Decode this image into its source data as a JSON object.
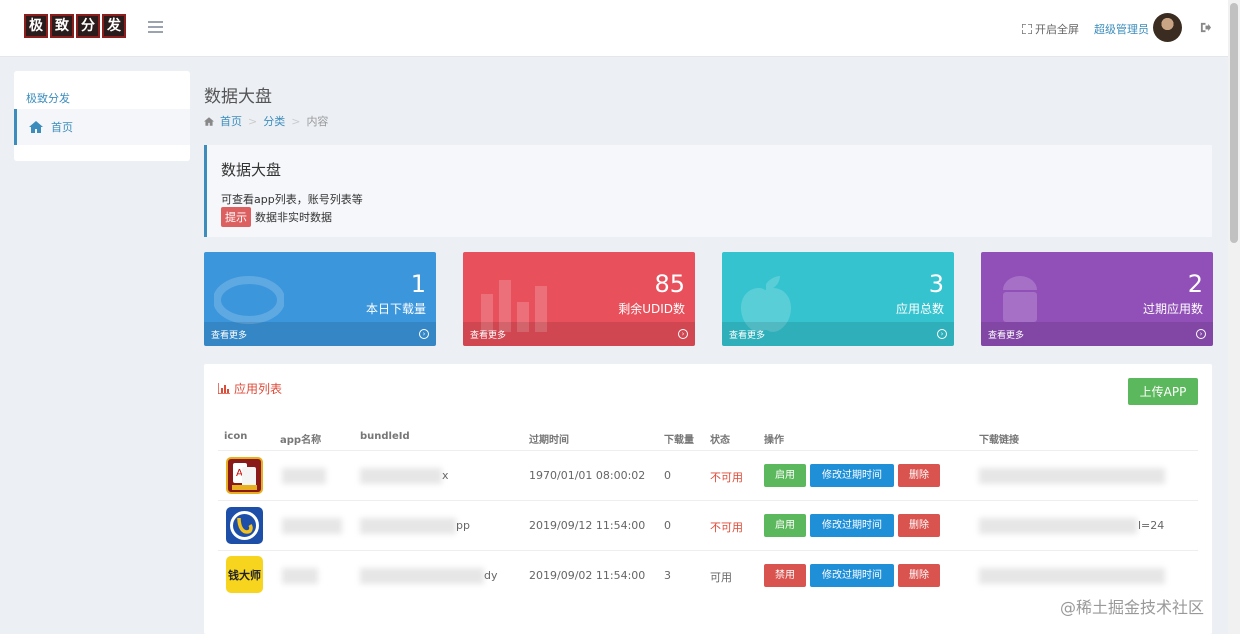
{
  "header": {
    "logo_chars": [
      "极",
      "致",
      "分",
      "发"
    ],
    "fullscreen_label": "开启全屏",
    "admin_name": "超级管理员"
  },
  "sidebar": {
    "title": "极致分发",
    "items": [
      {
        "label": "首页",
        "icon": "home-icon"
      }
    ]
  },
  "page": {
    "title": "数据大盘",
    "breadcrumb": [
      "首页",
      "分类",
      "内容"
    ]
  },
  "callout": {
    "title": "数据大盘",
    "description": "可查看app列表，账号列表等",
    "tip_badge": "提示",
    "tip_text": "数据非实时数据"
  },
  "stats": [
    {
      "value": "1",
      "label": "本日下载量",
      "more": "查看更多",
      "color": "#3c96dc"
    },
    {
      "value": "85",
      "label": "剩余UDID数",
      "more": "查看更多",
      "color": "#e8505b"
    },
    {
      "value": "3",
      "label": "应用总数",
      "more": "查看更多",
      "color": "#35c3cf"
    },
    {
      "value": "2",
      "label": "过期应用数",
      "more": "查看更多",
      "color": "#9150b8"
    }
  ],
  "app_list": {
    "title": "应用列表",
    "upload_label": "上传APP",
    "columns": [
      "icon",
      "app名称",
      "bundleId",
      "过期时间",
      "下载量",
      "状态",
      "操作",
      "下载链接"
    ],
    "rows": [
      {
        "bundle_tail": "x",
        "expire": "1970/01/01 08:00:02",
        "downloads": "0",
        "status": "不可用",
        "toggle": "启用",
        "edit": "修改过期时间",
        "delete": "删除",
        "link_tail": ""
      },
      {
        "bundle_tail": "pp",
        "expire": "2019/09/12 11:54:00",
        "downloads": "0",
        "status": "不可用",
        "toggle": "启用",
        "edit": "修改过期时间",
        "delete": "删除",
        "link_tail": "l=24"
      },
      {
        "bundle_tail": "dy",
        "expire": "2019/09/02 11:54:00",
        "downloads": "3",
        "status": "可用",
        "toggle": "禁用",
        "edit": "修改过期时间",
        "delete": "删除",
        "link_tail": ""
      }
    ]
  },
  "watermark": "@稀土掘金技术社区"
}
